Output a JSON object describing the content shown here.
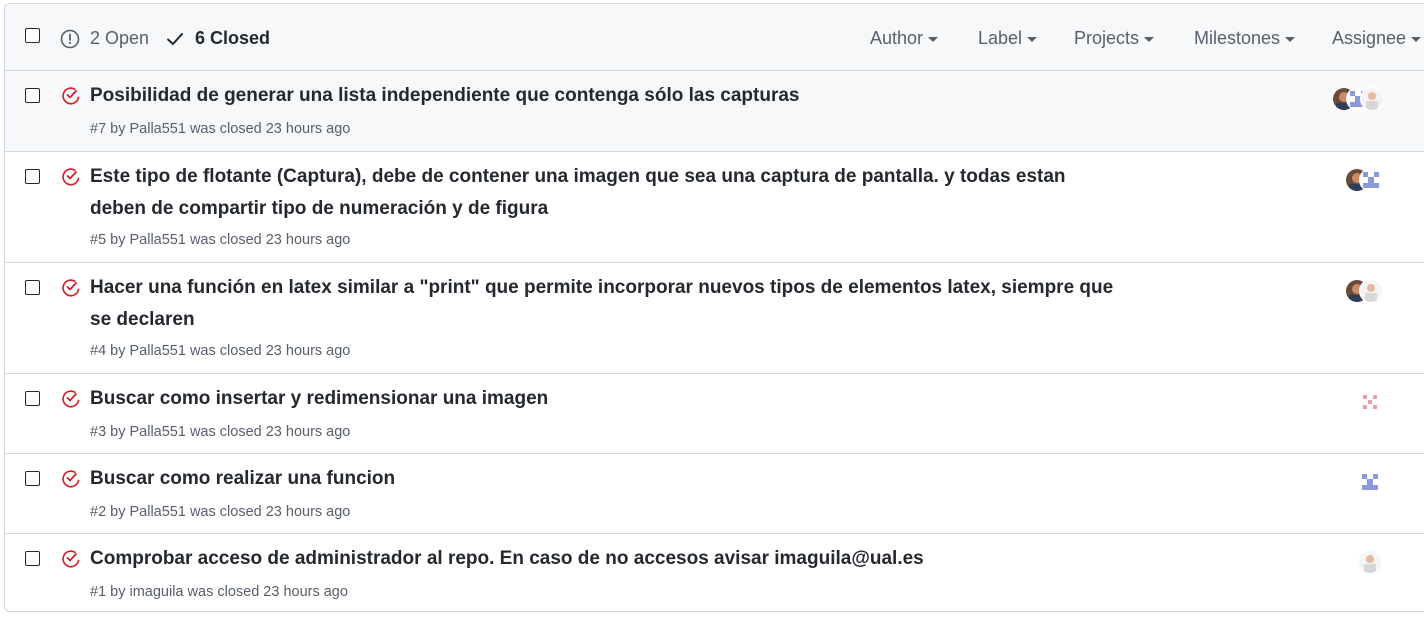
{
  "header": {
    "open_label": "2 Open",
    "closed_label": "6 Closed",
    "filters": [
      "Author",
      "Label",
      "Projects",
      "Milestones",
      "Assignee"
    ]
  },
  "issues": [
    {
      "title": "Posibilidad de generar una lista independiente que contenga sólo las capturas",
      "meta": "#7 by Palla551 was closed 23 hours ago",
      "avatars": [
        "photo-avatar",
        "identicon-blue",
        "photo-avatar-light"
      ]
    },
    {
      "title": "Este tipo de flotante (Captura), debe de contener una imagen que sea una captura de pantalla. y todas estan deben de compartir tipo de numeración y de figura",
      "meta": "#5 by Palla551 was closed 23 hours ago",
      "avatars": [
        "photo-avatar",
        "identicon-blue"
      ]
    },
    {
      "title": "Hacer una función en latex similar a \"print\" que permite incorporar nuevos tipos de elementos latex, siempre que se declaren",
      "meta": "#4 by Palla551 was closed 23 hours ago",
      "avatars": [
        "photo-avatar",
        "photo-avatar-light"
      ]
    },
    {
      "title": "Buscar como insertar y redimensionar una imagen",
      "meta": "#3 by Palla551 was closed 23 hours ago",
      "avatars": [
        "identicon-red"
      ]
    },
    {
      "title": "Buscar como realizar una funcion",
      "meta": "#2 by Palla551 was closed 23 hours ago",
      "avatars": [
        "identicon-blue"
      ]
    },
    {
      "title": "Comprobar acceso de administrador al repo. En caso de no accesos avisar imaguila@ual.es",
      "meta": "#1 by imaguila was closed 23 hours ago",
      "avatars": [
        "photo-avatar-light"
      ]
    }
  ],
  "colors": {
    "closed_icon": "#cf222e",
    "identicon_blue": "#8a9ad8",
    "identicon_red": "#e8a0a8"
  }
}
